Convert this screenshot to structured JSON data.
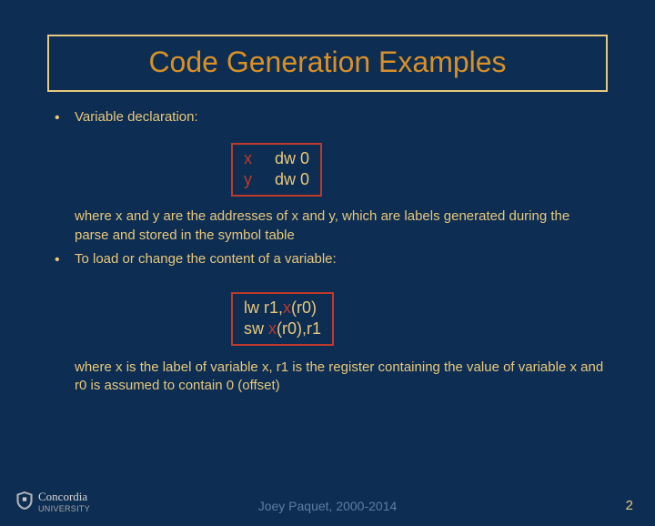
{
  "title": "Code Generation Examples",
  "bullets": {
    "b1": "Variable declaration:",
    "b2": "To load or change the content of a variable:"
  },
  "code1": {
    "l1a": "x",
    "l1b": "dw 0",
    "l2a": "y",
    "l2b": "dw 0"
  },
  "note1": "where x and y are the addresses of x and y, which are labels generated during the parse and stored in the symbol table",
  "code2": {
    "l1_pre": "lw r1,",
    "l1_x": "x",
    "l1_post": "(r0)",
    "l2_pre": "sw ",
    "l2_x": "x",
    "l2_post": "(r0),r1"
  },
  "note2": "where x is the label of variable x, r1 is the register containing the value of variable x and r0 is assumed to contain 0 (offset)",
  "footer": {
    "credit": "Joey Paquet, 2000-2014",
    "page": "2",
    "logo_name": "Concordia",
    "logo_sub": "UNIVERSITY"
  }
}
